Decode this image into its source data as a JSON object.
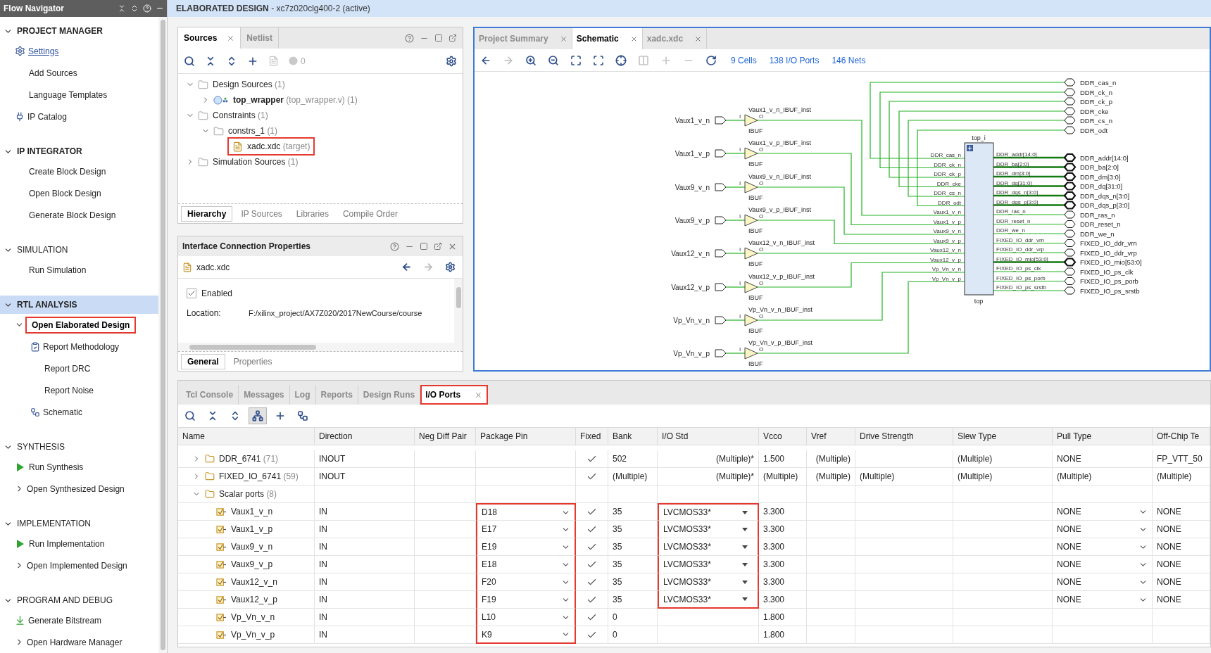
{
  "banner": "**ELABORATED DESIGN** - xc7z020clg400-2 (active)",
  "flow_navigator": {
    "title": "Flow Navigator",
    "sections": [
      {
        "title": "PROJECT MANAGER",
        "emphasized": true,
        "expanded": true,
        "selected": false,
        "items": [
          {
            "label": "Settings",
            "kind": "link",
            "selected": false,
            "highlighted": false
          },
          {
            "label": "Add Sources",
            "kind": "plain",
            "selected": false,
            "highlighted": false
          },
          {
            "label": "Language Templates",
            "kind": "plain",
            "selected": false,
            "highlighted": false
          },
          {
            "label": "IP Catalog",
            "kind": "catalog",
            "selected": false,
            "highlighted": false
          }
        ]
      },
      {
        "title": "IP INTEGRATOR",
        "emphasized": true,
        "expanded": true,
        "selected": false,
        "items": [
          {
            "label": "Create Block Design",
            "kind": "plain",
            "selected": false,
            "highlighted": false
          },
          {
            "label": "Open Block Design",
            "kind": "plain",
            "selected": false,
            "highlighted": false
          },
          {
            "label": "Generate Block Design",
            "kind": "plain",
            "selected": false,
            "highlighted": false
          }
        ]
      },
      {
        "title": "SIMULATION",
        "emphasized": false,
        "expanded": true,
        "selected": false,
        "items": [
          {
            "label": "Run Simulation",
            "kind": "plain",
            "selected": false,
            "highlighted": false
          }
        ]
      },
      {
        "title": "RTL ANALYSIS",
        "emphasized": true,
        "expanded": true,
        "selected": true,
        "items": [
          {
            "label": "Open Elaborated Design",
            "kind": "expandable",
            "expanded": true,
            "selected": true,
            "highlighted": true,
            "children": [
              {
                "label": "Report Methodology",
                "kind": "report",
                "selected": false,
                "highlighted": false
              },
              {
                "label": "Report DRC",
                "kind": "plain",
                "selected": false,
                "highlighted": false
              },
              {
                "label": "Report Noise",
                "kind": "plain",
                "selected": false,
                "highlighted": false
              },
              {
                "label": "Schematic",
                "kind": "schematic",
                "selected": false,
                "highlighted": false
              }
            ]
          }
        ]
      },
      {
        "title": "SYNTHESIS",
        "emphasized": false,
        "expanded": true,
        "selected": false,
        "items": [
          {
            "label": "Run Synthesis",
            "kind": "run",
            "selected": false,
            "highlighted": false
          },
          {
            "label": "Open Synthesized Design",
            "kind": "expandable",
            "expanded": false,
            "selected": false,
            "highlighted": false
          }
        ]
      },
      {
        "title": "IMPLEMENTATION",
        "emphasized": false,
        "expanded": true,
        "selected": false,
        "items": [
          {
            "label": "Run Implementation",
            "kind": "run",
            "selected": false,
            "highlighted": false
          },
          {
            "label": "Open Implemented Design",
            "kind": "expandable",
            "expanded": false,
            "selected": false,
            "highlighted": false
          }
        ]
      },
      {
        "title": "PROGRAM AND DEBUG",
        "emphasized": false,
        "expanded": true,
        "selected": false,
        "items": [
          {
            "label": "Generate Bitstream",
            "kind": "bitstream",
            "selected": false,
            "highlighted": false
          },
          {
            "label": "Open Hardware Manager",
            "kind": "expandable",
            "expanded": false,
            "selected": false,
            "highlighted": false
          }
        ]
      }
    ]
  },
  "sources": {
    "tabs": [
      {
        "label": "Sources",
        "selected": true,
        "closable": true
      },
      {
        "label": "Netlist",
        "selected": false,
        "closable": false
      }
    ],
    "messages_count": "0",
    "tree": [
      {
        "label": "Design Sources",
        "count": "(1)",
        "kind": "folder",
        "expanded": true,
        "highlighted": false,
        "children": [
          {
            "label": "top_wrapper",
            "detail": "(top_wrapper.v)",
            "count": "(1)",
            "kind": "module",
            "expanded": false,
            "highlighted": false
          }
        ]
      },
      {
        "label": "Constraints",
        "count": "(1)",
        "kind": "folder",
        "expanded": true,
        "highlighted": false,
        "children": [
          {
            "label": "constrs_1",
            "count": "(1)",
            "kind": "folder",
            "expanded": true,
            "highlighted": false,
            "children": [
              {
                "label": "xadc.xdc",
                "detail": "(target)",
                "kind": "file",
                "highlighted": true
              }
            ]
          }
        ]
      },
      {
        "label": "Simulation Sources",
        "count": "(1)",
        "kind": "folder",
        "expanded": false,
        "highlighted": false
      }
    ],
    "bottom_tabs": [
      {
        "label": "Hierarchy",
        "selected": true
      },
      {
        "label": "IP Sources",
        "selected": false
      },
      {
        "label": "Libraries",
        "selected": false
      },
      {
        "label": "Compile Order",
        "selected": false
      }
    ]
  },
  "properties": {
    "title": "Interface Connection Properties",
    "file": "xadc.xdc",
    "enabled": {
      "label": "Enabled",
      "checked": true
    },
    "location": {
      "label": "Location:",
      "value": "F:/xilinx_project/AX7Z020/2017NewCourse/course"
    },
    "tabs": [
      {
        "label": "General",
        "selected": true
      },
      {
        "label": "Properties",
        "selected": false
      }
    ]
  },
  "schematic": {
    "tabs": [
      {
        "label": "Project Summary",
        "selected": false
      },
      {
        "label": "Schematic",
        "selected": true
      },
      {
        "label": "xadc.xdc",
        "selected": false
      }
    ],
    "links": [
      "9 Cells",
      "138 I/O Ports",
      "146 Nets"
    ],
    "input_ports": [
      {
        "name": "Vaux1_v_n",
        "instance": "Vaux1_v_n_IBUF_inst",
        "cell": "IBUF",
        "pin_in": "I",
        "pin_out": "O"
      },
      {
        "name": "Vaux1_v_p",
        "instance": "Vaux1_v_p_IBUF_inst",
        "cell": "IBUF",
        "pin_in": "I",
        "pin_out": "O"
      },
      {
        "name": "Vaux9_v_n",
        "instance": "Vaux9_v_n_IBUF_inst",
        "cell": "IBUF",
        "pin_in": "I",
        "pin_out": "O"
      },
      {
        "name": "Vaux9_v_p",
        "instance": "Vaux9_v_p_IBUF_inst",
        "cell": "IBUF",
        "pin_in": "I",
        "pin_out": "O"
      },
      {
        "name": "Vaux12_v_n",
        "instance": "Vaux12_v_n_IBUF_inst",
        "cell": "IBUF",
        "pin_in": "I",
        "pin_out": "O"
      },
      {
        "name": "Vaux12_v_p",
        "instance": "Vaux12_v_p_IBUF_inst",
        "cell": "IBUF",
        "pin_in": "I",
        "pin_out": "O"
      },
      {
        "name": "Vp_Vn_v_n",
        "instance": "Vp_Vn_v_n_IBUF_inst",
        "cell": "IBUF",
        "pin_in": "I",
        "pin_out": "O"
      },
      {
        "name": "Vp_Vn_v_p",
        "instance": "Vp_Vn_v_p_IBUF_inst",
        "cell": "IBUF",
        "pin_in": "I",
        "pin_out": "O"
      }
    ],
    "block": {
      "instance": "top_i",
      "cell": "top",
      "input_pins": [
        "DDR_cas_n",
        "DDR_ck_n",
        "DDR_ck_p",
        "DDR_cke",
        "DDR_cs_n",
        "DDR_odt",
        "Vaux1_v_n",
        "Vaux1_v_p",
        "Vaux9_v_n",
        "Vaux9_v_p",
        "Vaux12_v_n",
        "Vaux12_v_p",
        "Vp_Vn_v_n",
        "Vp_Vn_v_p"
      ],
      "output_pins": [
        "DDR_addr[14:0]",
        "DDR_ba[2:0]",
        "DDR_dm[3:0]",
        "DDR_dq[31:0]",
        "DDR_dqs_n[3:0]",
        "DDR_dqs_p[3:0]",
        "DDR_ras_n",
        "DDR_reset_n",
        "DDR_we_n",
        "FIXED_IO_ddr_vrn",
        "FIXED_IO_ddr_vrp",
        "FIXED_IO_mio[53:0]",
        "FIXED_IO_ps_clk",
        "FIXED_IO_ps_porb",
        "FIXED_IO_ps_srstb"
      ]
    },
    "output_ports": [
      {
        "name": "DDR_cas_n",
        "kind": "scalar"
      },
      {
        "name": "DDR_ck_n",
        "kind": "scalar"
      },
      {
        "name": "DDR_ck_p",
        "kind": "scalar"
      },
      {
        "name": "DDR_cke",
        "kind": "scalar"
      },
      {
        "name": "DDR_cs_n",
        "kind": "scalar"
      },
      {
        "name": "DDR_odt",
        "kind": "scalar"
      },
      {
        "name": "DDR_addr[14:0]",
        "kind": "bus"
      },
      {
        "name": "DDR_ba[2:0]",
        "kind": "bus"
      },
      {
        "name": "DDR_dm[3:0]",
        "kind": "bus"
      },
      {
        "name": "DDR_dq[31:0]",
        "kind": "bus"
      },
      {
        "name": "DDR_dqs_n[3:0]",
        "kind": "bus"
      },
      {
        "name": "DDR_dqs_p[3:0]",
        "kind": "bus"
      },
      {
        "name": "DDR_ras_n",
        "kind": "scalar"
      },
      {
        "name": "DDR_reset_n",
        "kind": "scalar"
      },
      {
        "name": "DDR_we_n",
        "kind": "scalar"
      },
      {
        "name": "FIXED_IO_ddr_vrn",
        "kind": "scalar"
      },
      {
        "name": "FIXED_IO_ddr_vrp",
        "kind": "scalar"
      },
      {
        "name": "FIXED_IO_mio[53:0]",
        "kind": "bus"
      },
      {
        "name": "FIXED_IO_ps_clk",
        "kind": "scalar"
      },
      {
        "name": "FIXED_IO_ps_porb",
        "kind": "scalar"
      },
      {
        "name": "FIXED_IO_ps_srstb",
        "kind": "scalar"
      }
    ]
  },
  "io_panel": {
    "tabs": [
      {
        "label": "Tcl Console",
        "selected": false,
        "highlighted": false
      },
      {
        "label": "Messages",
        "selected": false,
        "highlighted": false
      },
      {
        "label": "Log",
        "selected": false,
        "highlighted": false
      },
      {
        "label": "Reports",
        "selected": false,
        "highlighted": false
      },
      {
        "label": "Design Runs",
        "selected": false,
        "highlighted": false
      },
      {
        "label": "I/O Ports",
        "selected": true,
        "highlighted": true
      }
    ],
    "toolbar": [
      {
        "kind": "search",
        "pressed": false
      },
      {
        "kind": "collapse",
        "pressed": false
      },
      {
        "kind": "expand",
        "pressed": false
      },
      {
        "kind": "group",
        "pressed": true
      },
      {
        "kind": "add",
        "pressed": false
      },
      {
        "kind": "schematic",
        "pressed": false
      }
    ],
    "columns": [
      "Name",
      "Direction",
      "Neg Diff Pair",
      "Package Pin",
      "Fixed",
      "Bank",
      "I/O Std",
      "Vcco",
      "Vref",
      "Drive Strength",
      "Slew Type",
      "Pull Type",
      "Off-Chip Te"
    ],
    "rows": [
      {
        "kind": "group",
        "name": "DDR_6741",
        "count": "(71)",
        "expanded": false,
        "cells": [
          {
            "kind": "text",
            "text": "INOUT"
          },
          {
            "kind": "blank"
          },
          {
            "kind": "blank"
          },
          {
            "kind": "check",
            "checked": true
          },
          {
            "kind": "text",
            "text": "502"
          },
          {
            "kind": "text",
            "text": "(Multiple)*"
          },
          {
            "kind": "text",
            "text": "1.500"
          },
          {
            "kind": "text",
            "text": "(Multiple)"
          },
          {
            "kind": "blank"
          },
          {
            "kind": "text",
            "text": "(Multiple)"
          },
          {
            "kind": "text",
            "text": "NONE"
          },
          {
            "kind": "text",
            "text": "FP_VTT_50"
          }
        ]
      },
      {
        "kind": "group",
        "name": "FIXED_IO_6741",
        "count": "(59)",
        "expanded": false,
        "cells": [
          {
            "kind": "text",
            "text": "INOUT"
          },
          {
            "kind": "blank"
          },
          {
            "kind": "blank"
          },
          {
            "kind": "check",
            "checked": true
          },
          {
            "kind": "text",
            "text": "(Multiple)"
          },
          {
            "kind": "text",
            "text": "(Multiple)*"
          },
          {
            "kind": "text",
            "text": "(Multiple)"
          },
          {
            "kind": "text",
            "text": "(Multiple)"
          },
          {
            "kind": "text",
            "text": "(Multiple)"
          },
          {
            "kind": "text",
            "text": "(Multiple)"
          },
          {
            "kind": "text",
            "text": "(Multiple)"
          },
          {
            "kind": "text",
            "text": "(Multiple)"
          }
        ]
      },
      {
        "kind": "group",
        "name": "Scalar ports",
        "count": "(8)",
        "expanded": true,
        "children": [
          {
            "kind": "port",
            "name": "Vaux1_v_n",
            "cells": [
              {
                "kind": "text",
                "text": "IN"
              },
              {
                "kind": "blank"
              },
              {
                "kind": "dropdown",
                "text": "D18",
                "highlighted": true
              },
              {
                "kind": "check",
                "checked": true
              },
              {
                "kind": "text",
                "text": "35"
              },
              {
                "kind": "select",
                "text": "LVCMOS33*",
                "highlighted": true
              },
              {
                "kind": "text",
                "text": "3.300"
              },
              {
                "kind": "blank"
              },
              {
                "kind": "blank"
              },
              {
                "kind": "blank"
              },
              {
                "kind": "dropdown",
                "text": "NONE",
                "highlighted": false
              },
              {
                "kind": "text",
                "text": "NONE"
              }
            ]
          },
          {
            "kind": "port",
            "name": "Vaux1_v_p",
            "cells": [
              {
                "kind": "text",
                "text": "IN"
              },
              {
                "kind": "blank"
              },
              {
                "kind": "dropdown",
                "text": "E17",
                "highlighted": true
              },
              {
                "kind": "check",
                "checked": true
              },
              {
                "kind": "text",
                "text": "35"
              },
              {
                "kind": "select",
                "text": "LVCMOS33*",
                "highlighted": true
              },
              {
                "kind": "text",
                "text": "3.300"
              },
              {
                "kind": "blank"
              },
              {
                "kind": "blank"
              },
              {
                "kind": "blank"
              },
              {
                "kind": "dropdown",
                "text": "NONE",
                "highlighted": false
              },
              {
                "kind": "text",
                "text": "NONE"
              }
            ]
          },
          {
            "kind": "port",
            "name": "Vaux9_v_n",
            "cells": [
              {
                "kind": "text",
                "text": "IN"
              },
              {
                "kind": "blank"
              },
              {
                "kind": "dropdown",
                "text": "E19",
                "highlighted": true
              },
              {
                "kind": "check",
                "checked": true
              },
              {
                "kind": "text",
                "text": "35"
              },
              {
                "kind": "select",
                "text": "LVCMOS33*",
                "highlighted": true
              },
              {
                "kind": "text",
                "text": "3.300"
              },
              {
                "kind": "blank"
              },
              {
                "kind": "blank"
              },
              {
                "kind": "blank"
              },
              {
                "kind": "dropdown",
                "text": "NONE",
                "highlighted": false
              },
              {
                "kind": "text",
                "text": "NONE"
              }
            ]
          },
          {
            "kind": "port",
            "name": "Vaux9_v_p",
            "cells": [
              {
                "kind": "text",
                "text": "IN"
              },
              {
                "kind": "blank"
              },
              {
                "kind": "dropdown",
                "text": "E18",
                "highlighted": true
              },
              {
                "kind": "check",
                "checked": true
              },
              {
                "kind": "text",
                "text": "35"
              },
              {
                "kind": "select",
                "text": "LVCMOS33*",
                "highlighted": true
              },
              {
                "kind": "text",
                "text": "3.300"
              },
              {
                "kind": "blank"
              },
              {
                "kind": "blank"
              },
              {
                "kind": "blank"
              },
              {
                "kind": "dropdown",
                "text": "NONE",
                "highlighted": false
              },
              {
                "kind": "text",
                "text": "NONE"
              }
            ]
          },
          {
            "kind": "port",
            "name": "Vaux12_v_n",
            "cells": [
              {
                "kind": "text",
                "text": "IN"
              },
              {
                "kind": "blank"
              },
              {
                "kind": "dropdown",
                "text": "F20",
                "highlighted": true
              },
              {
                "kind": "check",
                "checked": true
              },
              {
                "kind": "text",
                "text": "35"
              },
              {
                "kind": "select",
                "text": "LVCMOS33*",
                "highlighted": true
              },
              {
                "kind": "text",
                "text": "3.300"
              },
              {
                "kind": "blank"
              },
              {
                "kind": "blank"
              },
              {
                "kind": "blank"
              },
              {
                "kind": "dropdown",
                "text": "NONE",
                "highlighted": false
              },
              {
                "kind": "text",
                "text": "NONE"
              }
            ]
          },
          {
            "kind": "port",
            "name": "Vaux12_v_p",
            "cells": [
              {
                "kind": "text",
                "text": "IN"
              },
              {
                "kind": "blank"
              },
              {
                "kind": "dropdown",
                "text": "F19",
                "highlighted": true
              },
              {
                "kind": "check",
                "checked": true
              },
              {
                "kind": "text",
                "text": "35"
              },
              {
                "kind": "select",
                "text": "LVCMOS33*",
                "highlighted": true
              },
              {
                "kind": "text",
                "text": "3.300"
              },
              {
                "kind": "blank"
              },
              {
                "kind": "blank"
              },
              {
                "kind": "blank"
              },
              {
                "kind": "dropdown",
                "text": "NONE",
                "highlighted": false
              },
              {
                "kind": "text",
                "text": "NONE"
              }
            ]
          },
          {
            "kind": "port",
            "name": "Vp_Vn_v_n",
            "cells": [
              {
                "kind": "text",
                "text": "IN"
              },
              {
                "kind": "blank"
              },
              {
                "kind": "dropdown",
                "text": "L10",
                "highlighted": true
              },
              {
                "kind": "check",
                "checked": true
              },
              {
                "kind": "text",
                "text": "0"
              },
              {
                "kind": "blank"
              },
              {
                "kind": "text",
                "text": "1.800"
              },
              {
                "kind": "blank"
              },
              {
                "kind": "blank"
              },
              {
                "kind": "blank"
              },
              {
                "kind": "blank"
              },
              {
                "kind": "blank"
              }
            ]
          },
          {
            "kind": "port",
            "name": "Vp_Vn_v_p",
            "cells": [
              {
                "kind": "text",
                "text": "IN"
              },
              {
                "kind": "blank"
              },
              {
                "kind": "dropdown",
                "text": "K9",
                "highlighted": true
              },
              {
                "kind": "check",
                "checked": true
              },
              {
                "kind": "text",
                "text": "0"
              },
              {
                "kind": "blank"
              },
              {
                "kind": "text",
                "text": "1.800"
              },
              {
                "kind": "blank"
              },
              {
                "kind": "blank"
              },
              {
                "kind": "blank"
              },
              {
                "kind": "blank"
              },
              {
                "kind": "blank"
              }
            ]
          }
        ]
      }
    ]
  }
}
